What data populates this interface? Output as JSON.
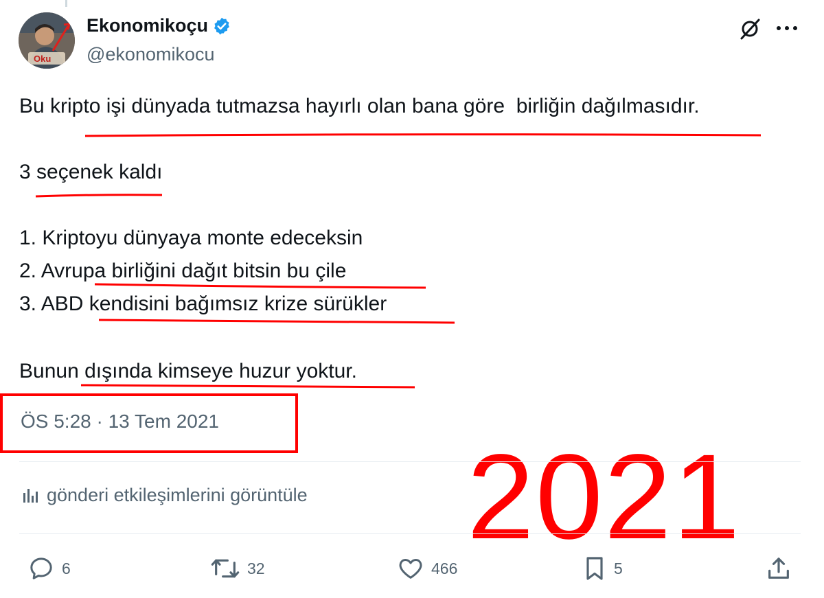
{
  "author": {
    "display_name": "Ekonomikoçu",
    "handle": "@ekonomikocu",
    "avatar_badge": "Oku"
  },
  "tweet": {
    "lines": [
      "Bu kripto işi dünyada tutmazsa hayırlı olan bana göre  birliğin dağılmasıdır.",
      "3 seçenek kaldı",
      "1. Kriptoyu dünyaya monte edeceksin",
      "2. Avrupa birliğini dağıt bitsin bu çile",
      "3. ABD kendisini bağımsız krize sürükler",
      "Bunun dışında kimseye huzur yoktur."
    ],
    "timestamp": "ÖS 5:28 · 13 Tem 2021"
  },
  "analytics": {
    "label": "gönderi etkileşimlerini görüntüle"
  },
  "overlay": {
    "year": "2021",
    "color": "#ff0000"
  },
  "actions": {
    "reply": {
      "icon": "reply-icon",
      "count": "6"
    },
    "repost": {
      "icon": "repost-icon",
      "count": "32"
    },
    "like": {
      "icon": "heart-icon",
      "count": "466"
    },
    "bookmark": {
      "icon": "bookmark-icon",
      "count": "5"
    },
    "share": {
      "icon": "share-icon"
    }
  },
  "colors": {
    "text": "#0f1419",
    "secondary": "#536471",
    "verified": "#1d9bf0",
    "annotation": "#ff0000"
  }
}
